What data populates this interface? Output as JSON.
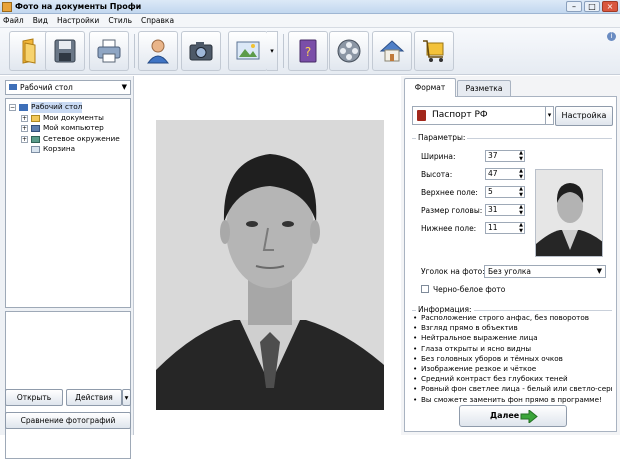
{
  "window": {
    "title": "Фото на документы Профи"
  },
  "menu": [
    "Файл",
    "Вид",
    "Настройки",
    "Стиль",
    "Справка"
  ],
  "toolbar": {
    "buttons": [
      "open-project-icon",
      "save-icon",
      "print-icon",
      "person-icon",
      "camera-icon",
      "image-edit-icon",
      "help-book-icon",
      "film-icon",
      "home-icon",
      "shopping-cart-icon"
    ]
  },
  "left": {
    "location_select": "Рабочий стол",
    "tree": [
      {
        "label": "Рабочий стол",
        "level": 0,
        "expander": "−"
      },
      {
        "label": "Мои документы",
        "level": 1,
        "expander": "+"
      },
      {
        "label": "Мой компьютер",
        "level": 1,
        "expander": "+"
      },
      {
        "label": "Сетевое окружение",
        "level": 1,
        "expander": "+"
      },
      {
        "label": "Корзина",
        "level": 1,
        "expander": ""
      }
    ],
    "open_button": "Открыть",
    "actions_button": "Действия",
    "compare_button": "Сравнение фотографий"
  },
  "right": {
    "tabs": [
      "Формат",
      "Разметка"
    ],
    "active_tab": "Формат",
    "document_type": "Паспорт РФ",
    "settings_button": "Настройка",
    "params_title": "Параметры:",
    "params": [
      {
        "label": "Ширина:",
        "value": "37"
      },
      {
        "label": "Высота:",
        "value": "47"
      },
      {
        "label": "Верхнее поле:",
        "value": "5"
      },
      {
        "label": "Размер головы:",
        "value": "31"
      },
      {
        "label": "Нижнее поле:",
        "value": "11"
      }
    ],
    "corner_label": "Уголок на фото:",
    "corner_value": "Без уголка",
    "bw_label": "Черно-белое фото",
    "bw_checked": false,
    "info_title": "Информация:",
    "info_items": [
      "Расположение строго анфас, без поворотов",
      "Взгляд прямо в объектив",
      "Нейтральное выражение лица",
      "Глаза открыты и ясно видны",
      "Без головных уборов и тёмных очков",
      "Изображение резкое и чёткое",
      "Средний контраст без глубоких теней",
      "Ровный фон светлее лица - белый или светло-серь",
      "Вы сможете заменить фон прямо в программе!"
    ],
    "next_button": "Далее"
  },
  "colors": {
    "accent_blue": "#3e6fb8",
    "next_arrow_green": "#3aa53a",
    "passport_red": "#a1271c"
  }
}
